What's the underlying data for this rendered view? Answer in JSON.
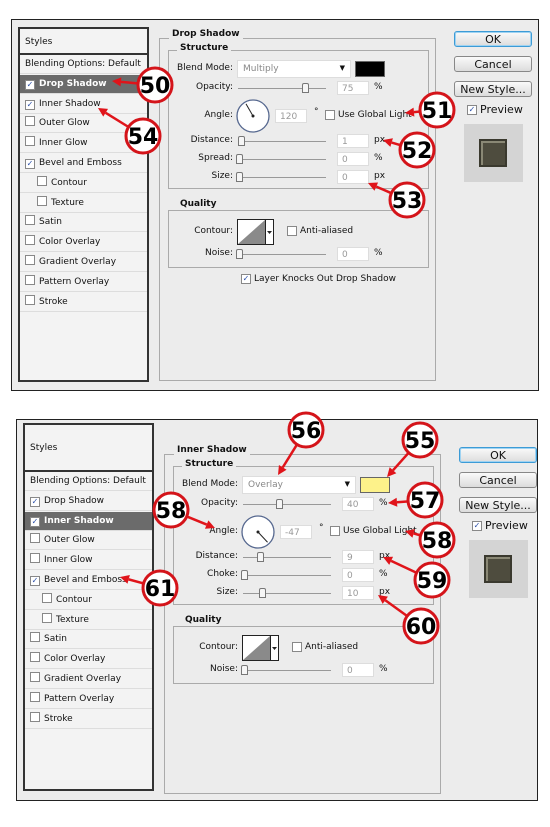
{
  "dialogs": [
    {
      "styles": {
        "header": "Styles",
        "items": [
          {
            "label": "Blending Options: Default",
            "checkbox": false,
            "checked": false,
            "selected": false,
            "indent": false
          },
          {
            "label": "Drop Shadow",
            "checkbox": true,
            "checked": true,
            "selected": true,
            "indent": false
          },
          {
            "label": "Inner Shadow",
            "checkbox": true,
            "checked": true,
            "selected": false,
            "indent": false
          },
          {
            "label": "Outer Glow",
            "checkbox": true,
            "checked": false,
            "selected": false,
            "indent": false
          },
          {
            "label": "Inner Glow",
            "checkbox": true,
            "checked": false,
            "selected": false,
            "indent": false
          },
          {
            "label": "Bevel and Emboss",
            "checkbox": true,
            "checked": true,
            "selected": false,
            "indent": false
          },
          {
            "label": "Contour",
            "checkbox": true,
            "checked": false,
            "selected": false,
            "indent": true
          },
          {
            "label": "Texture",
            "checkbox": true,
            "checked": false,
            "selected": false,
            "indent": true
          },
          {
            "label": "Satin",
            "checkbox": true,
            "checked": false,
            "selected": false,
            "indent": false
          },
          {
            "label": "Color Overlay",
            "checkbox": true,
            "checked": false,
            "selected": false,
            "indent": false
          },
          {
            "label": "Gradient Overlay",
            "checkbox": true,
            "checked": false,
            "selected": false,
            "indent": false
          },
          {
            "label": "Pattern Overlay",
            "checkbox": true,
            "checked": false,
            "selected": false,
            "indent": false
          },
          {
            "label": "Stroke",
            "checkbox": true,
            "checked": false,
            "selected": false,
            "indent": false
          }
        ]
      },
      "panel": {
        "title": "Drop Shadow",
        "structure_title": "Structure",
        "blend_mode_label": "Blend Mode:",
        "blend_mode": "Multiply",
        "color": "#000000",
        "opacity_label": "Opacity:",
        "opacity": "75",
        "opacity_unit": "%",
        "angle_label": "Angle:",
        "angle": "120",
        "angle_unit": "°",
        "use_global_light_label": "Use Global Light",
        "use_global_light": false,
        "rows": [
          {
            "label": "Distance:",
            "value": "1",
            "unit": "px"
          },
          {
            "label": "Spread:",
            "value": "0",
            "unit": "%"
          },
          {
            "label": "Size:",
            "value": "0",
            "unit": "px"
          }
        ],
        "quality_title": "Quality",
        "contour_label": "Contour:",
        "anti_aliased_label": "Anti-aliased",
        "anti_aliased": false,
        "noise_label": "Noise:",
        "noise": "0",
        "noise_unit": "%",
        "knockout_label": "Layer Knocks Out Drop Shadow",
        "knockout": true
      },
      "buttons": {
        "ok": "OK",
        "cancel": "Cancel",
        "new_style": "New Style..."
      },
      "preview_label": "Preview",
      "preview": true
    },
    {
      "styles": {
        "header": "Styles",
        "items": [
          {
            "label": "Blending Options: Default",
            "checkbox": false,
            "checked": false,
            "selected": false,
            "indent": false
          },
          {
            "label": "Drop Shadow",
            "checkbox": true,
            "checked": true,
            "selected": false,
            "indent": false
          },
          {
            "label": "Inner Shadow",
            "checkbox": true,
            "checked": true,
            "selected": true,
            "indent": false
          },
          {
            "label": "Outer Glow",
            "checkbox": true,
            "checked": false,
            "selected": false,
            "indent": false
          },
          {
            "label": "Inner Glow",
            "checkbox": true,
            "checked": false,
            "selected": false,
            "indent": false
          },
          {
            "label": "Bevel and Emboss",
            "checkbox": true,
            "checked": true,
            "selected": false,
            "indent": false
          },
          {
            "label": "Contour",
            "checkbox": true,
            "checked": false,
            "selected": false,
            "indent": true
          },
          {
            "label": "Texture",
            "checkbox": true,
            "checked": false,
            "selected": false,
            "indent": true
          },
          {
            "label": "Satin",
            "checkbox": true,
            "checked": false,
            "selected": false,
            "indent": false
          },
          {
            "label": "Color Overlay",
            "checkbox": true,
            "checked": false,
            "selected": false,
            "indent": false
          },
          {
            "label": "Gradient Overlay",
            "checkbox": true,
            "checked": false,
            "selected": false,
            "indent": false
          },
          {
            "label": "Pattern Overlay",
            "checkbox": true,
            "checked": false,
            "selected": false,
            "indent": false
          },
          {
            "label": "Stroke",
            "checkbox": true,
            "checked": false,
            "selected": false,
            "indent": false
          }
        ]
      },
      "panel": {
        "title": "Inner Shadow",
        "structure_title": "Structure",
        "blend_mode_label": "Blend Mode:",
        "blend_mode": "Overlay",
        "color": "#fdf28a",
        "opacity_label": "Opacity:",
        "opacity": "40",
        "opacity_unit": "%",
        "angle_label": "Angle:",
        "angle": "-47",
        "angle_unit": "°",
        "use_global_light_label": "Use Global Light",
        "use_global_light": false,
        "rows": [
          {
            "label": "Distance:",
            "value": "9",
            "unit": "px"
          },
          {
            "label": "Choke:",
            "value": "0",
            "unit": "%"
          },
          {
            "label": "Size:",
            "value": "10",
            "unit": "px"
          }
        ],
        "quality_title": "Quality",
        "contour_label": "Contour:",
        "anti_aliased_label": "Anti-aliased",
        "anti_aliased": false,
        "noise_label": "Noise:",
        "noise": "0",
        "noise_unit": "%"
      },
      "buttons": {
        "ok": "OK",
        "cancel": "Cancel",
        "new_style": "New Style..."
      },
      "preview_label": "Preview",
      "preview": true
    }
  ],
  "callouts": [
    "50",
    "54",
    "51",
    "52",
    "53",
    "56",
    "55",
    "57",
    "58",
    "58",
    "59",
    "60",
    "61"
  ],
  "colors": {
    "callout_ring": "#d4141a",
    "arrow": "#e0141a",
    "selected_row": "#6b6b6b",
    "ok_button_border": "#3c9bd6"
  }
}
